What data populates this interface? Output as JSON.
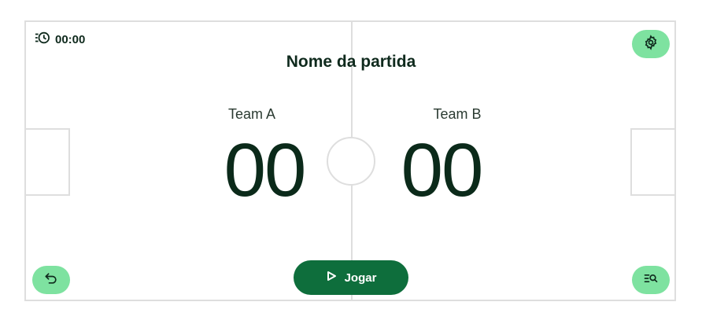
{
  "timer": {
    "icon": "history-clock-icon",
    "value": "00:00"
  },
  "match": {
    "title": "Nome da partida"
  },
  "teams": [
    {
      "name": "Team A",
      "score": "00"
    },
    {
      "name": "Team B",
      "score": "00"
    }
  ],
  "actions": {
    "settings_icon": "gear-icon",
    "undo_icon": "undo-icon",
    "history_icon": "list-search-icon",
    "play_icon": "play-icon",
    "play_label": "Jogar"
  },
  "colors": {
    "accent_light": "#7ee2a0",
    "accent_dark": "#0e6e3c",
    "text_dark": "#0b2a1a",
    "field_lines": "#dedede"
  }
}
